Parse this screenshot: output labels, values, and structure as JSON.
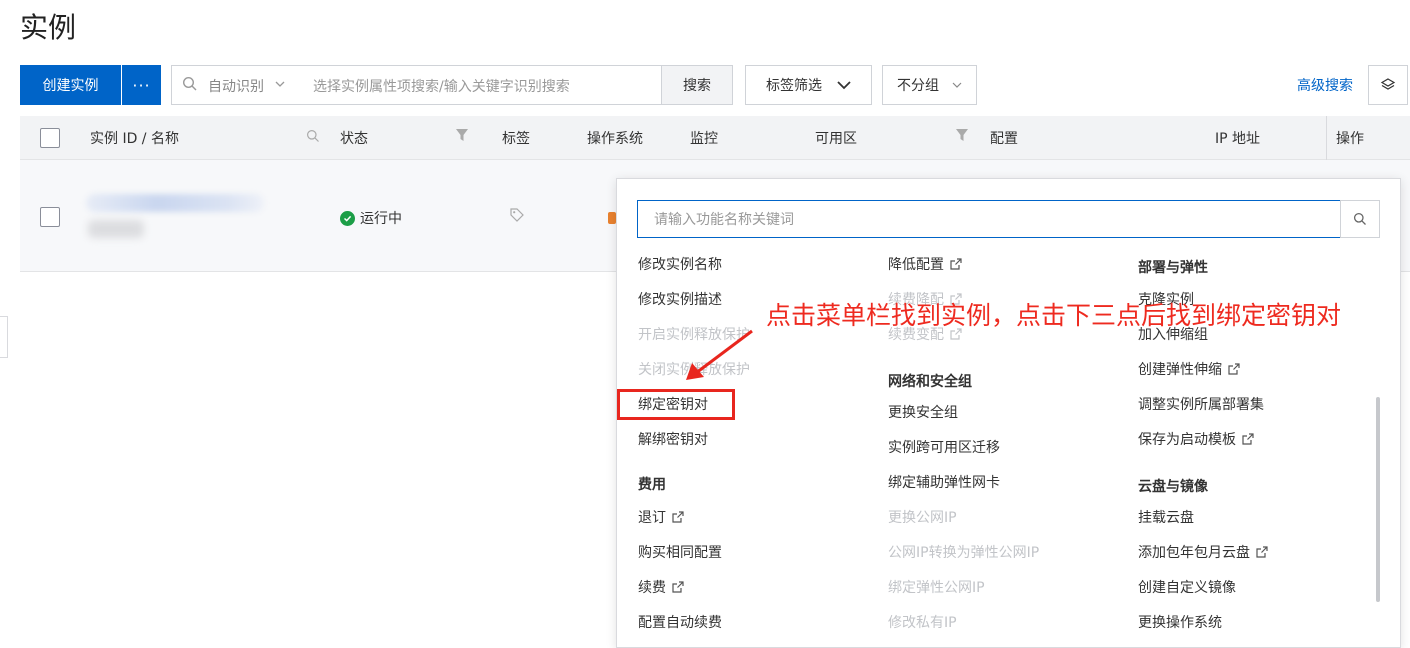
{
  "page": {
    "title": "实例"
  },
  "toolbar": {
    "create_label": "创建实例",
    "more_label": "···",
    "search_mode": "自动识别",
    "search_placeholder": "选择实例属性项搜索/输入关键字识别搜索",
    "search_button": "搜索",
    "tag_filter": "标签筛选",
    "group_select": "不分组",
    "advanced_search": "高级搜索"
  },
  "table": {
    "headers": {
      "id_name": "实例 ID / 名称",
      "status": "状态",
      "tags": "标签",
      "os": "操作系统",
      "monitor": "监控",
      "zone": "可用区",
      "config": "配置",
      "ip": "IP 地址",
      "actions": "操作"
    },
    "rows": [
      {
        "status": "运行中"
      }
    ]
  },
  "dropdown": {
    "search_placeholder": "请输入功能名称关键词",
    "col1": [
      {
        "label": "修改实例名称",
        "state": "normal"
      },
      {
        "label": "修改实例描述",
        "state": "normal"
      },
      {
        "label": "开启实例释放保护",
        "state": "disabled"
      },
      {
        "label": "关闭实例释放保护",
        "state": "disabled"
      },
      {
        "label": "绑定密钥对",
        "state": "normal"
      },
      {
        "label": "解绑密钥对",
        "state": "normal"
      },
      {
        "label": "费用",
        "state": "heading"
      },
      {
        "label": "退订",
        "state": "normal"
      },
      {
        "label": "购买相同配置",
        "state": "normal"
      },
      {
        "label": "续费",
        "state": "normal"
      },
      {
        "label": "配置自动续费",
        "state": "normal"
      }
    ],
    "col2": [
      {
        "label": "降低配置",
        "state": "normal"
      },
      {
        "label": "续费降配",
        "state": "disabled"
      },
      {
        "label": "续费变配",
        "state": "disabled"
      },
      {
        "label": "网络和安全组",
        "state": "heading"
      },
      {
        "label": "更换安全组",
        "state": "normal"
      },
      {
        "label": "实例跨可用区迁移",
        "state": "normal"
      },
      {
        "label": "绑定辅助弹性网卡",
        "state": "normal"
      },
      {
        "label": "更换公网IP",
        "state": "disabled"
      },
      {
        "label": "公网IP转换为弹性公网IP",
        "state": "disabled"
      },
      {
        "label": "绑定弹性公网IP",
        "state": "disabled"
      },
      {
        "label": "修改私有IP",
        "state": "disabled"
      }
    ],
    "col3": [
      {
        "label": "部署与弹性",
        "state": "heading"
      },
      {
        "label": "克隆实例",
        "state": "normal"
      },
      {
        "label": "加入伸缩组",
        "state": "normal"
      },
      {
        "label": "创建弹性伸缩",
        "state": "normal"
      },
      {
        "label": "调整实例所属部署集",
        "state": "normal"
      },
      {
        "label": "保存为启动模板",
        "state": "normal"
      },
      {
        "label": "云盘与镜像",
        "state": "heading"
      },
      {
        "label": "挂载云盘",
        "state": "normal"
      },
      {
        "label": "添加包年包月云盘",
        "state": "normal"
      },
      {
        "label": "创建自定义镜像",
        "state": "normal"
      },
      {
        "label": "更换操作系统",
        "state": "normal"
      }
    ]
  },
  "annotation": {
    "text": "点击菜单栏找到实例，点击下三点后找到绑定密钥对"
  },
  "colors": {
    "primary": "#0064c8",
    "annotation": "#ee2a1f",
    "success": "#1c9e47"
  }
}
